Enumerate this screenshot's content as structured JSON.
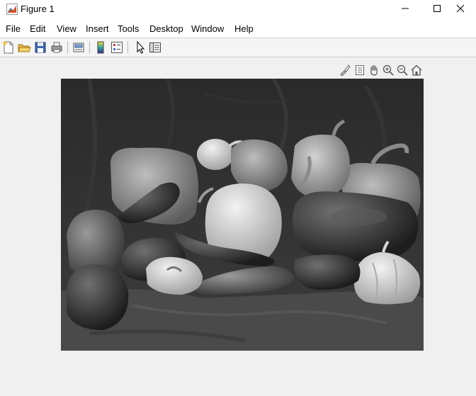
{
  "window": {
    "title": "Figure 1",
    "icon": "matlab-figure-icon",
    "controls": [
      "minimize-icon",
      "maximize-icon",
      "close-icon"
    ]
  },
  "menubar": {
    "items": [
      {
        "label": "File"
      },
      {
        "label": "Edit"
      },
      {
        "label": "View"
      },
      {
        "label": "Insert"
      },
      {
        "label": "Tools"
      },
      {
        "label": "Desktop"
      },
      {
        "label": "Window"
      },
      {
        "label": "Help"
      }
    ]
  },
  "toolbar": {
    "buttons": [
      "new-figure-icon",
      "open-file-icon",
      "save-icon",
      "print-icon",
      "link-plot-icon",
      "insert-colorbar-icon",
      "insert-legend-icon",
      "edit-plot-icon",
      "open-property-inspector-icon"
    ]
  },
  "axes_toolbar": {
    "buttons": [
      "brush-icon",
      "data-tips-icon",
      "pan-icon",
      "zoom-in-icon",
      "zoom-out-icon",
      "restore-view-icon"
    ]
  },
  "image": {
    "content": "grayscale still life of bell peppers, chili peppers, an onion and a garlic bulb on draped cloth",
    "colors": {
      "background": "#2e2e2e",
      "cloth": "#4a4a4a"
    }
  }
}
